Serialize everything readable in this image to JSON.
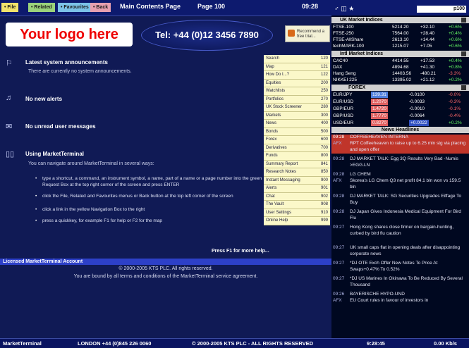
{
  "topbar": {
    "file": "• File",
    "related": "• Related",
    "favourites": "• Favourites",
    "back": "• Back",
    "title": "Main Contents Page",
    "page": "Page 100",
    "time": "09:28"
  },
  "header": {
    "logo": "Your logo here",
    "tel": "Tel: +44 (0)12 3456 7890",
    "recommend": "Recommend a free trial..."
  },
  "sections": {
    "announce_title": "Latest system announcements",
    "announce_text": "There are currently no system announcements.",
    "alerts_title": "No new alerts",
    "messages_title": "No unread user messages",
    "using_title": "Using MarketTerminal",
    "using_text": "You can navigate around MarketTerminal in several ways:",
    "bullets": [
      "type a shortcut, a command, an instrument symbol, a name, part of a name or a page number into the green Request Box at the top right corner of the screen and press ENTER",
      "click the File, Related and Favourites menus or Back button at the top left corner of the screen",
      "click a link in the yellow Navigation Box to the right",
      "press a quickkey, for example F1 for help or F2 for the map"
    ],
    "press_help": "Press F1 for more help..."
  },
  "nav": [
    {
      "label": "Search",
      "num": "120"
    },
    {
      "label": "Map",
      "num": "121"
    },
    {
      "label": "How Do I...?",
      "num": "122"
    },
    {
      "label": "Equities",
      "num": "200"
    },
    {
      "label": "Watchlists",
      "num": "250"
    },
    {
      "label": "Portfolios",
      "num": "270"
    },
    {
      "label": "UK Stock Screener",
      "num": "280"
    },
    {
      "label": "Markets",
      "num": "300"
    },
    {
      "label": "News",
      "num": "400"
    },
    {
      "label": "Bonds",
      "num": "500"
    },
    {
      "label": "Forex",
      "num": "600"
    },
    {
      "label": "Derivatives",
      "num": "700"
    },
    {
      "label": "Funds",
      "num": "800"
    },
    {
      "label": "Summary Report",
      "num": "841"
    },
    {
      "label": "Research Notes",
      "num": "850"
    },
    {
      "label": "Instant Messaging",
      "num": "900"
    },
    {
      "label": "Alerts",
      "num": "901"
    },
    {
      "label": "Chat",
      "num": "902"
    },
    {
      "label": "The Vault",
      "num": "908"
    },
    {
      "label": "User Settings",
      "num": "910"
    },
    {
      "label": "Online Help",
      "num": "999"
    }
  ],
  "license": {
    "bar": "Licensed MarketTerminal Account",
    "line1": "© 2000-2005 KTS PLC. All rights reserved.",
    "line2": "You are bound by all terms and conditions of the MarketTerminal service agreement."
  },
  "status": {
    "app": "MarketTerminal",
    "phone": "LONDON +44 (0)845 226 0060",
    "copyright": "© 2000-2005 KTS PLC - ALL RIGHTS RESERVED",
    "time": "9:28:45",
    "rate": "0.00 Kb/s"
  },
  "rightpanel": {
    "request": "p100",
    "uk_title": "UK Market Indices",
    "uk": [
      {
        "name": "FTSE-100",
        "val": "5214.20",
        "chg": "+32.10",
        "pct": "+0.6%"
      },
      {
        "name": "FTSE-250",
        "val": "7564.00",
        "chg": "+28.40",
        "pct": "+0.4%"
      },
      {
        "name": "FTSE-AllShare",
        "val": "2613.10",
        "chg": "+14.44",
        "pct": "+0.6%"
      },
      {
        "name": "techMARK-100",
        "val": "1215.07",
        "chg": "+7.05",
        "pct": "+0.6%"
      }
    ],
    "intl_title": "Intl Market Indices",
    "intl": [
      {
        "name": "CAC40",
        "val": "4414.55",
        "chg": "+17.53",
        "pct": "+0.4%"
      },
      {
        "name": "DAX",
        "val": "4894.68",
        "chg": "+41.30",
        "pct": "+0.8%"
      },
      {
        "name": "Hang Seng",
        "val": "14403.56",
        "chg": "-480.21",
        "pct": "-3.3%"
      },
      {
        "name": "NIKKEI 225",
        "val": "13395.02",
        "chg": "+21.12",
        "pct": "+0.2%"
      }
    ],
    "forex_title": "FOREX",
    "forex": [
      {
        "name": "EUR/JPY",
        "val": "139.31",
        "chg": "-0.0100",
        "pct": "-0.0%"
      },
      {
        "name": "EUR/USD",
        "val": "1.2070",
        "chg": "-0.0033",
        "pct": "-0.3%"
      },
      {
        "name": "GBP/EUR",
        "val": "1.4720",
        "chg": "-0.0010",
        "pct": "-0.1%"
      },
      {
        "name": "GBP/USD",
        "val": "1.7770",
        "chg": "-0.0064",
        "pct": "-0.4%"
      },
      {
        "name": "USD/EUR",
        "val": "0.8270",
        "chg": "+0.0022",
        "pct": "+0.2%"
      }
    ],
    "news_title": "News Headlines",
    "news": [
      {
        "time": "09:28",
        "src": "",
        "head": "COFFEEHEAVEN INTERNA"
      },
      {
        "time": "",
        "src": "AFX",
        "head": "RPT Coffeeheaven to raise up to 6.25 mln stg via placing and open offer"
      },
      {
        "time": "09:28",
        "src": "",
        "head": "DJ MARKET TALK: Egg 3Q Results Very Bad -Numis >EGG.LN"
      },
      {
        "time": "09:28",
        "src": "",
        "head": "LG CHEM"
      },
      {
        "time": "",
        "src": "AFX",
        "head": "Skorea's LG Chem Q3 net profit 84.1 bln won vs 159.5 bln"
      },
      {
        "time": "09:28",
        "src": "",
        "head": "DJ MARKET TALK: SG Securities Upgrades Eiffage To Buy"
      },
      {
        "time": "09:28",
        "src": "",
        "head": "DJ Japan Gives Indonesia Medical Equipment For Bird Flu"
      },
      {
        "time": "09:27",
        "src": "",
        "head": "Hong Kong shares close firmer on bargain-hunting, curbed by bird flu caution"
      },
      {
        "time": "09:27",
        "src": "",
        "head": "UK small caps flat in opening deals after disappointing corporate news"
      },
      {
        "time": "09:27",
        "src": "",
        "head": "*DJ OTE Exch Offer New Notes To Price At Swaps+0.47% To 0.52%"
      },
      {
        "time": "09:27",
        "src": "",
        "head": "*DJ US Marines In Okinawa To Be Reduced By Several Thousand"
      },
      {
        "time": "09:26",
        "src": "",
        "head": "BAYERISCHE HYPO-UND"
      },
      {
        "time": "",
        "src": "AFX",
        "head": "EU Court rules in favour of investors in"
      }
    ]
  },
  "colors": {
    "background": "#101a55",
    "nav_box": "#fbf8c9",
    "up": "#2a8a2a",
    "down": "#e06060",
    "logo_text": "#ee0000"
  }
}
